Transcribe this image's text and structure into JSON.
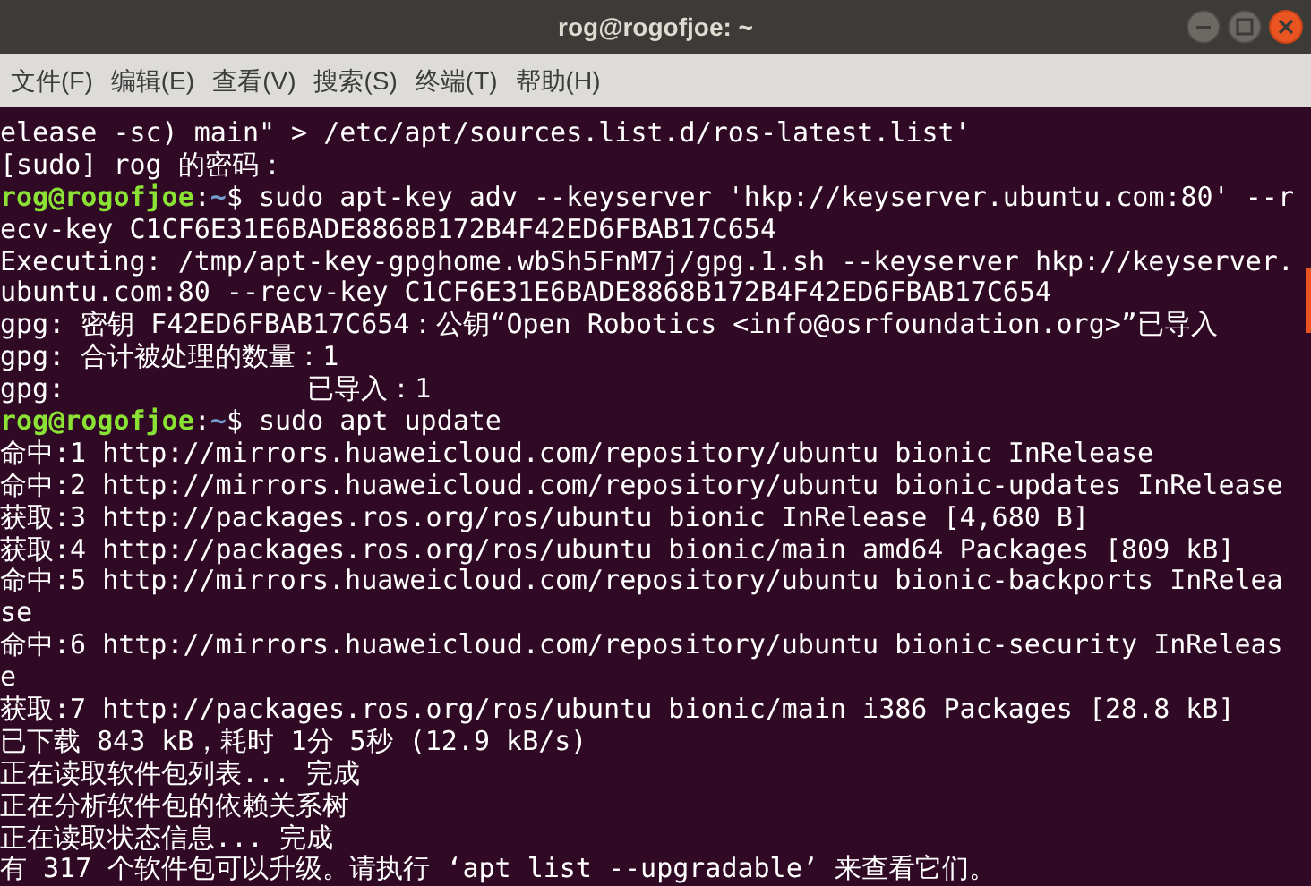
{
  "window": {
    "title": "rog@rogofjoe: ~"
  },
  "menu": [
    "文件(F)",
    "编辑(E)",
    "查看(V)",
    "搜索(S)",
    "终端(T)",
    "帮助(H)"
  ],
  "terminal": {
    "lines": [
      {
        "kind": "output",
        "text": "elease -sc) main\" > /etc/apt/sources.list.d/ros-latest.list'"
      },
      {
        "kind": "output",
        "text": "[sudo] rog 的密码："
      },
      {
        "kind": "prompt",
        "user_host": "rog@rogofjoe",
        "separator": ":",
        "path": "~",
        "symbol": "$",
        "command": "sudo apt-key adv --keyserver 'hkp://keyserver.ubuntu.com:80' --r"
      },
      {
        "kind": "output",
        "text": "ecv-key C1CF6E31E6BADE8868B172B4F42ED6FBAB17C654"
      },
      {
        "kind": "output",
        "text": "Executing: /tmp/apt-key-gpghome.wbSh5FnM7j/gpg.1.sh --keyserver hkp://keyserver."
      },
      {
        "kind": "output",
        "text": "ubuntu.com:80 --recv-key C1CF6E31E6BADE8868B172B4F42ED6FBAB17C654"
      },
      {
        "kind": "output",
        "text": "gpg: 密钥 F42ED6FBAB17C654：公钥“Open Robotics <info@osrfoundation.org>”已导入"
      },
      {
        "kind": "output",
        "text": "gpg: 合计被处理的数量：1"
      },
      {
        "kind": "output",
        "text": "gpg:               已导入：1"
      },
      {
        "kind": "prompt",
        "user_host": "rog@rogofjoe",
        "separator": ":",
        "path": "~",
        "symbol": "$",
        "command": "sudo apt update"
      },
      {
        "kind": "output",
        "text": "命中:1 http://mirrors.huaweicloud.com/repository/ubuntu bionic InRelease"
      },
      {
        "kind": "output",
        "text": "命中:2 http://mirrors.huaweicloud.com/repository/ubuntu bionic-updates InRelease"
      },
      {
        "kind": "output",
        "text": "获取:3 http://packages.ros.org/ros/ubuntu bionic InRelease [4,680 B]"
      },
      {
        "kind": "output",
        "text": "获取:4 http://packages.ros.org/ros/ubuntu bionic/main amd64 Packages [809 kB]"
      },
      {
        "kind": "output",
        "text": "命中:5 http://mirrors.huaweicloud.com/repository/ubuntu bionic-backports InRelea"
      },
      {
        "kind": "output",
        "text": "se"
      },
      {
        "kind": "output",
        "text": "命中:6 http://mirrors.huaweicloud.com/repository/ubuntu bionic-security InReleas"
      },
      {
        "kind": "output",
        "text": "e"
      },
      {
        "kind": "output",
        "text": "获取:7 http://packages.ros.org/ros/ubuntu bionic/main i386 Packages [28.8 kB]"
      },
      {
        "kind": "output",
        "text": "已下载 843 kB，耗时 1分 5秒 (12.9 kB/s)"
      },
      {
        "kind": "output",
        "text": "正在读取软件包列表... 完成"
      },
      {
        "kind": "output",
        "text": "正在分析软件包的依赖关系树"
      },
      {
        "kind": "output",
        "text": "正在读取状态信息... 完成"
      },
      {
        "kind": "output",
        "text": "有 317 个软件包可以升级。请执行 ‘apt list --upgradable’ 来查看它们。"
      }
    ]
  }
}
